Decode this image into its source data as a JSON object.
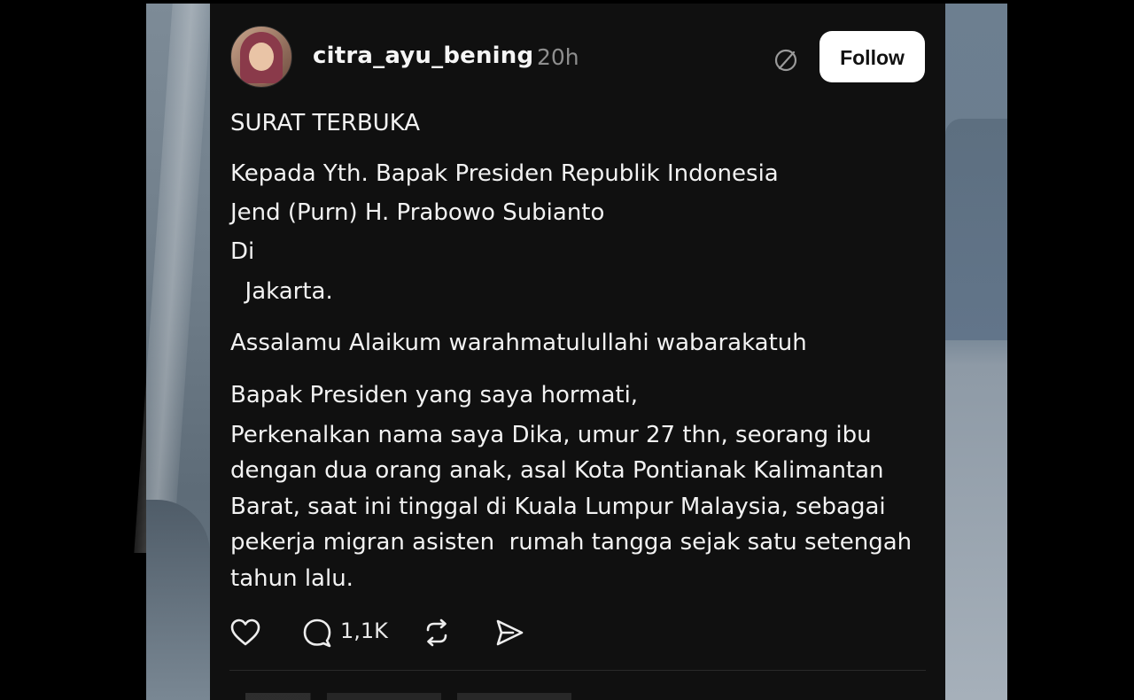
{
  "post": {
    "username": "citra_ayu_bening",
    "time": "20h",
    "follow_label": "Follow",
    "lines": {
      "l1": "SURAT TERBUKA",
      "l2": "Kepada Yth. Bapak Presiden Republik Indonesia",
      "l3": "Jend (Purn) H. Prabowo Subianto",
      "l4": "Di",
      "l5": "  Jakarta.",
      "l6": "Assalamu Alaikum warahmatulullahi wabarakatuh",
      "l7": "Bapak Presiden yang saya hormati,",
      "l8": "Perkenalkan nama saya Dika, umur 27 thn, seorang ibu",
      "l9": "dengan dua orang anak, asal Kota Pontianak Kalimantan",
      "l10": "Barat, saat ini tinggal di Kuala Lumpur Malaysia, sebagai",
      "l11": "pekerja migran asisten  rumah tangga sejak satu setengah",
      "l12": "tahun lalu."
    },
    "reply_count": "1,1K"
  },
  "icons": {
    "like": "heart-icon",
    "reply": "comment-icon",
    "repost": "repost-icon",
    "share": "send-icon",
    "verified": "verified-icon"
  }
}
